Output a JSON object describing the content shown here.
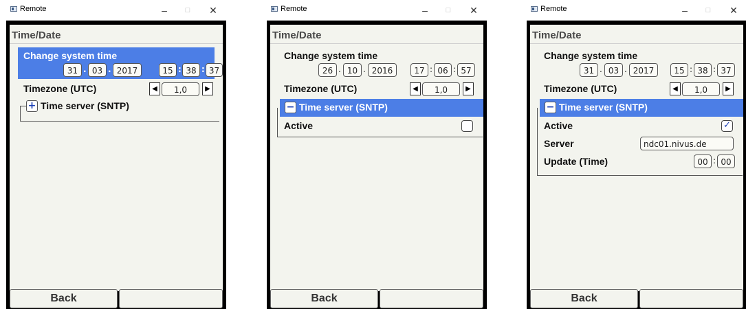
{
  "window_title": "Remote",
  "window_controls": {
    "minimize": "–",
    "maximize": "□",
    "close": "✕"
  },
  "page_title": "Time/Date",
  "labels": {
    "change_system_time": "Change system time",
    "timezone": "Timezone (UTC)",
    "time_server": "Time server (SNTP)",
    "active": "Active",
    "server": "Server",
    "update_time": "Update (Time)"
  },
  "separators": {
    "date": ".",
    "time": ":"
  },
  "expand_symbols": {
    "collapsed": "+",
    "expanded": "−"
  },
  "arrow_symbols": {
    "left": "◀",
    "right": "▶"
  },
  "check_symbol": "✓",
  "back_label": "Back",
  "screens": [
    {
      "date": {
        "day": "31",
        "month": "03",
        "year": "2017"
      },
      "time": {
        "hour": "15",
        "minute": "38",
        "second": "37"
      },
      "timezone_value": "1,0",
      "sntp_expanded": false
    },
    {
      "date": {
        "day": "26",
        "month": "10",
        "year": "2016"
      },
      "time": {
        "hour": "17",
        "minute": "06",
        "second": "57"
      },
      "timezone_value": "1,0",
      "sntp_expanded": true,
      "active_checked": false
    },
    {
      "date": {
        "day": "31",
        "month": "03",
        "year": "2017"
      },
      "time": {
        "hour": "15",
        "minute": "38",
        "second": "37"
      },
      "timezone_value": "1,0",
      "sntp_expanded": true,
      "active_checked": true,
      "server_value": "ndc01.nivus.de",
      "update_time": {
        "hour": "00",
        "minute": "00"
      }
    }
  ]
}
